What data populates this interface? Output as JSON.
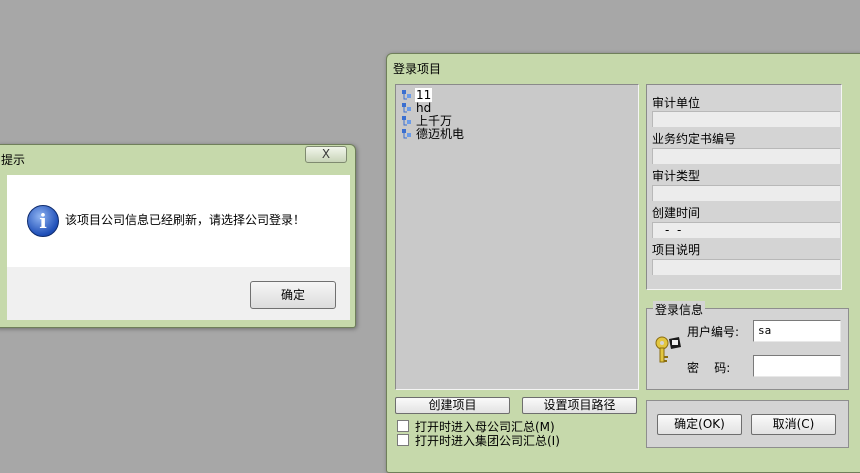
{
  "message_dialog": {
    "title": "提示",
    "close_label": "X",
    "message": "该项目公司信息已经刷新，请选择公司登录！",
    "ok_label": "确定"
  },
  "login_window": {
    "title": "登录项目",
    "projects": [
      {
        "label": "11",
        "selected": true
      },
      {
        "label": "hd",
        "selected": false
      },
      {
        "label": "上千万",
        "selected": false
      },
      {
        "label": "德迈机电",
        "selected": false
      }
    ],
    "details": {
      "audit_unit_label": "审计单位",
      "audit_unit_value": "",
      "engagement_no_label": "业务约定书编号",
      "engagement_no_value": "",
      "audit_type_label": "审计类型",
      "audit_type_value": "",
      "created_time_label": "创建时间",
      "created_time_value": "-  -",
      "description_label": "项目说明",
      "description_value": ""
    },
    "login_info": {
      "legend": "登录信息",
      "user_id_label": "用户编号:",
      "user_id_value": "sa",
      "password_label": "密    码:",
      "password_value": ""
    },
    "buttons": {
      "create_project": "创建项目",
      "set_path": "设置项目路径",
      "confirm": "确定(OK)",
      "cancel": "取消(C)"
    },
    "options": {
      "open_parent_summary": "打开时进入母公司汇总(M)",
      "open_group_summary": "打开时进入集团公司汇总(I)"
    }
  }
}
